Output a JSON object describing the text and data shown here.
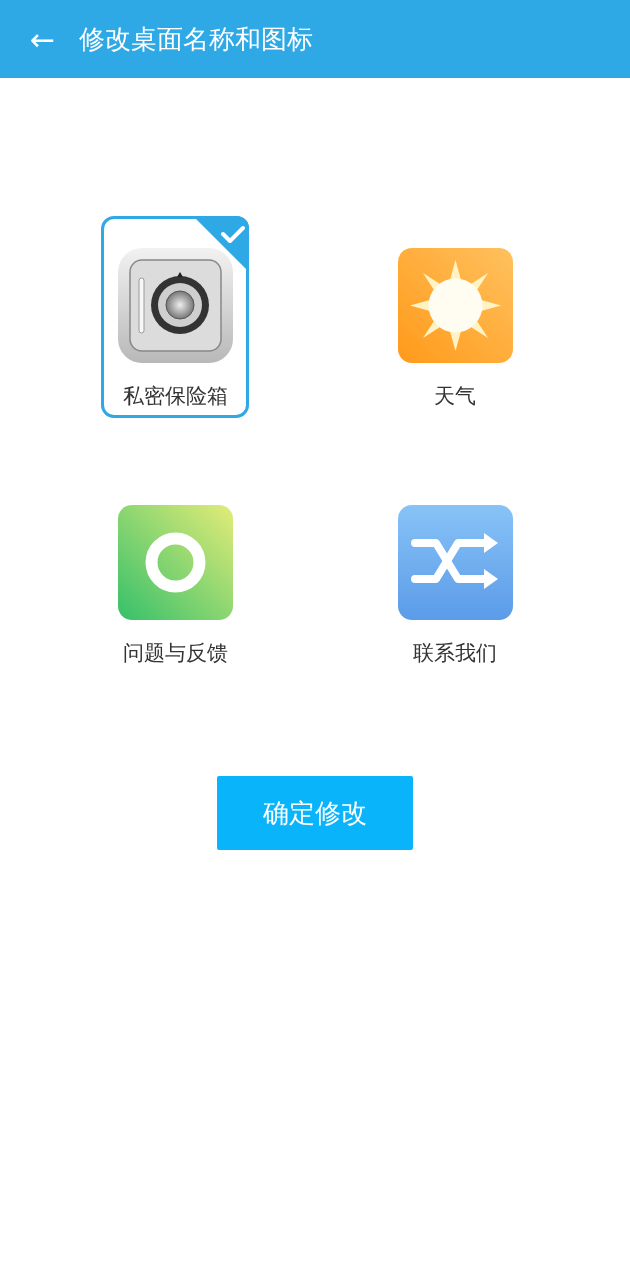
{
  "header": {
    "back_icon": "←",
    "title": "修改桌面名称和图标"
  },
  "items": [
    {
      "label": "私密保险箱",
      "kind": "safe",
      "selected": true
    },
    {
      "label": "天气",
      "kind": "sun",
      "selected": false
    },
    {
      "label": "问题与反馈",
      "kind": "ring",
      "selected": false
    },
    {
      "label": "联系我们",
      "kind": "shuffle",
      "selected": false
    }
  ],
  "confirm_button": "确定修改"
}
